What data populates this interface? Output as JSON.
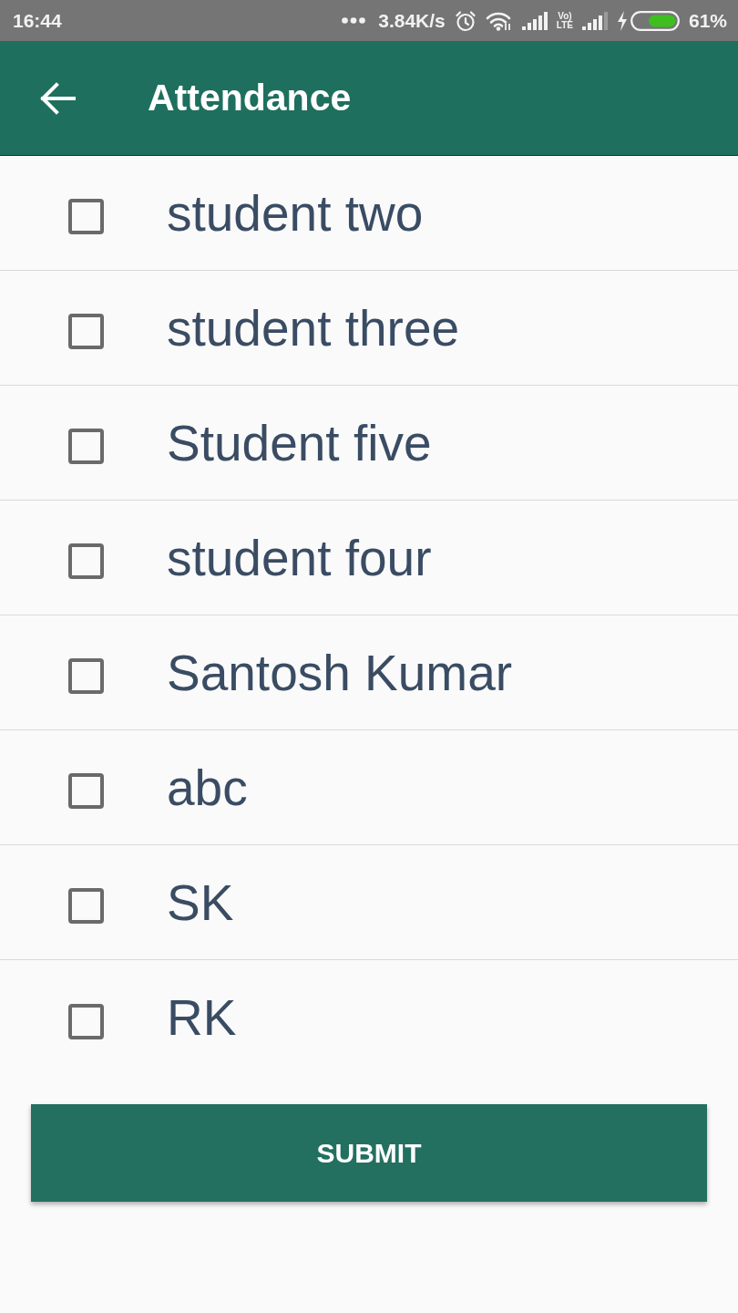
{
  "status_bar": {
    "time": "16:44",
    "speed": "3.84K/s",
    "network_badge": [
      "Vo)",
      "LTE"
    ],
    "battery": "61%"
  },
  "toolbar": {
    "title": "Attendance"
  },
  "students": [
    {
      "name": "student two",
      "checked": false
    },
    {
      "name": "student three",
      "checked": false
    },
    {
      "name": "Student five",
      "checked": false
    },
    {
      "name": "student four",
      "checked": false
    },
    {
      "name": "Santosh Kumar",
      "checked": false
    },
    {
      "name": "abc",
      "checked": false
    },
    {
      "name": "SK",
      "checked": false
    },
    {
      "name": "RK",
      "checked": false
    }
  ],
  "submit_button": {
    "label": "SUBMIT"
  }
}
